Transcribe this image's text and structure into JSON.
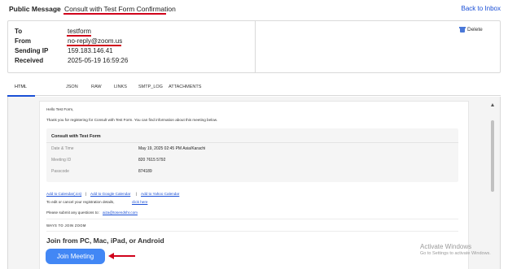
{
  "breadcrumb": {
    "root": "Public Message",
    "separator": ">",
    "current": "Consult with Test Form Confirmation"
  },
  "back_link": "Back to Inbox",
  "header": {
    "to_label": "To",
    "to_value": "testform",
    "from_label": "From",
    "from_value": "no-reply@zoom.us",
    "ip_label": "Sending IP",
    "ip_value": "159.183.146.41",
    "received_label": "Received",
    "received_value": "2025-05-19 16:59:26"
  },
  "delete_label": "Delete",
  "tabs": [
    {
      "label": "HTML",
      "active": true
    },
    {
      "label": "JSON",
      "active": false
    },
    {
      "label": "RAW",
      "active": false
    },
    {
      "label": "LINKS",
      "active": false
    },
    {
      "label": "SMTP_LOG",
      "active": false
    },
    {
      "label": "ATTACHMENTS",
      "active": false
    }
  ],
  "email": {
    "greeting": "Hello Test Form,",
    "intro": "Thank you for registering for Consult with Test Form. You can find information about this meeting below.",
    "meeting_title": "Consult with Test Form",
    "details": [
      {
        "label": "Date & Time",
        "value": "May 19, 2025 02:45 PM Asia/Karachi"
      },
      {
        "label": "Meeting ID",
        "value": "820 7615 5792"
      },
      {
        "label": "Passcode",
        "value": "874189"
      }
    ],
    "calendar_links": [
      "Add to Calendar(.ics)",
      "Add to Google Calendar",
      "Add to Yahoo Calendar"
    ],
    "link_separator": "|",
    "edit_text": "To edit or cancel your registration details,",
    "edit_link": "click here",
    "questions_text": "Please submit any questions to:",
    "questions_email": "aiza@tosendshr.com",
    "ways_heading": "WAYS TO JOIN ZOOM",
    "join_heading": "Join from PC, Mac, iPad, or Android",
    "join_button": "Join Meeting"
  },
  "watermark": {
    "line1": "Activate Windows",
    "line2": "Go to Settings to activate Windows."
  },
  "colors": {
    "annotation_red": "#d0021b",
    "link_blue": "#1a4fd6",
    "join_button": "#4287f5"
  }
}
